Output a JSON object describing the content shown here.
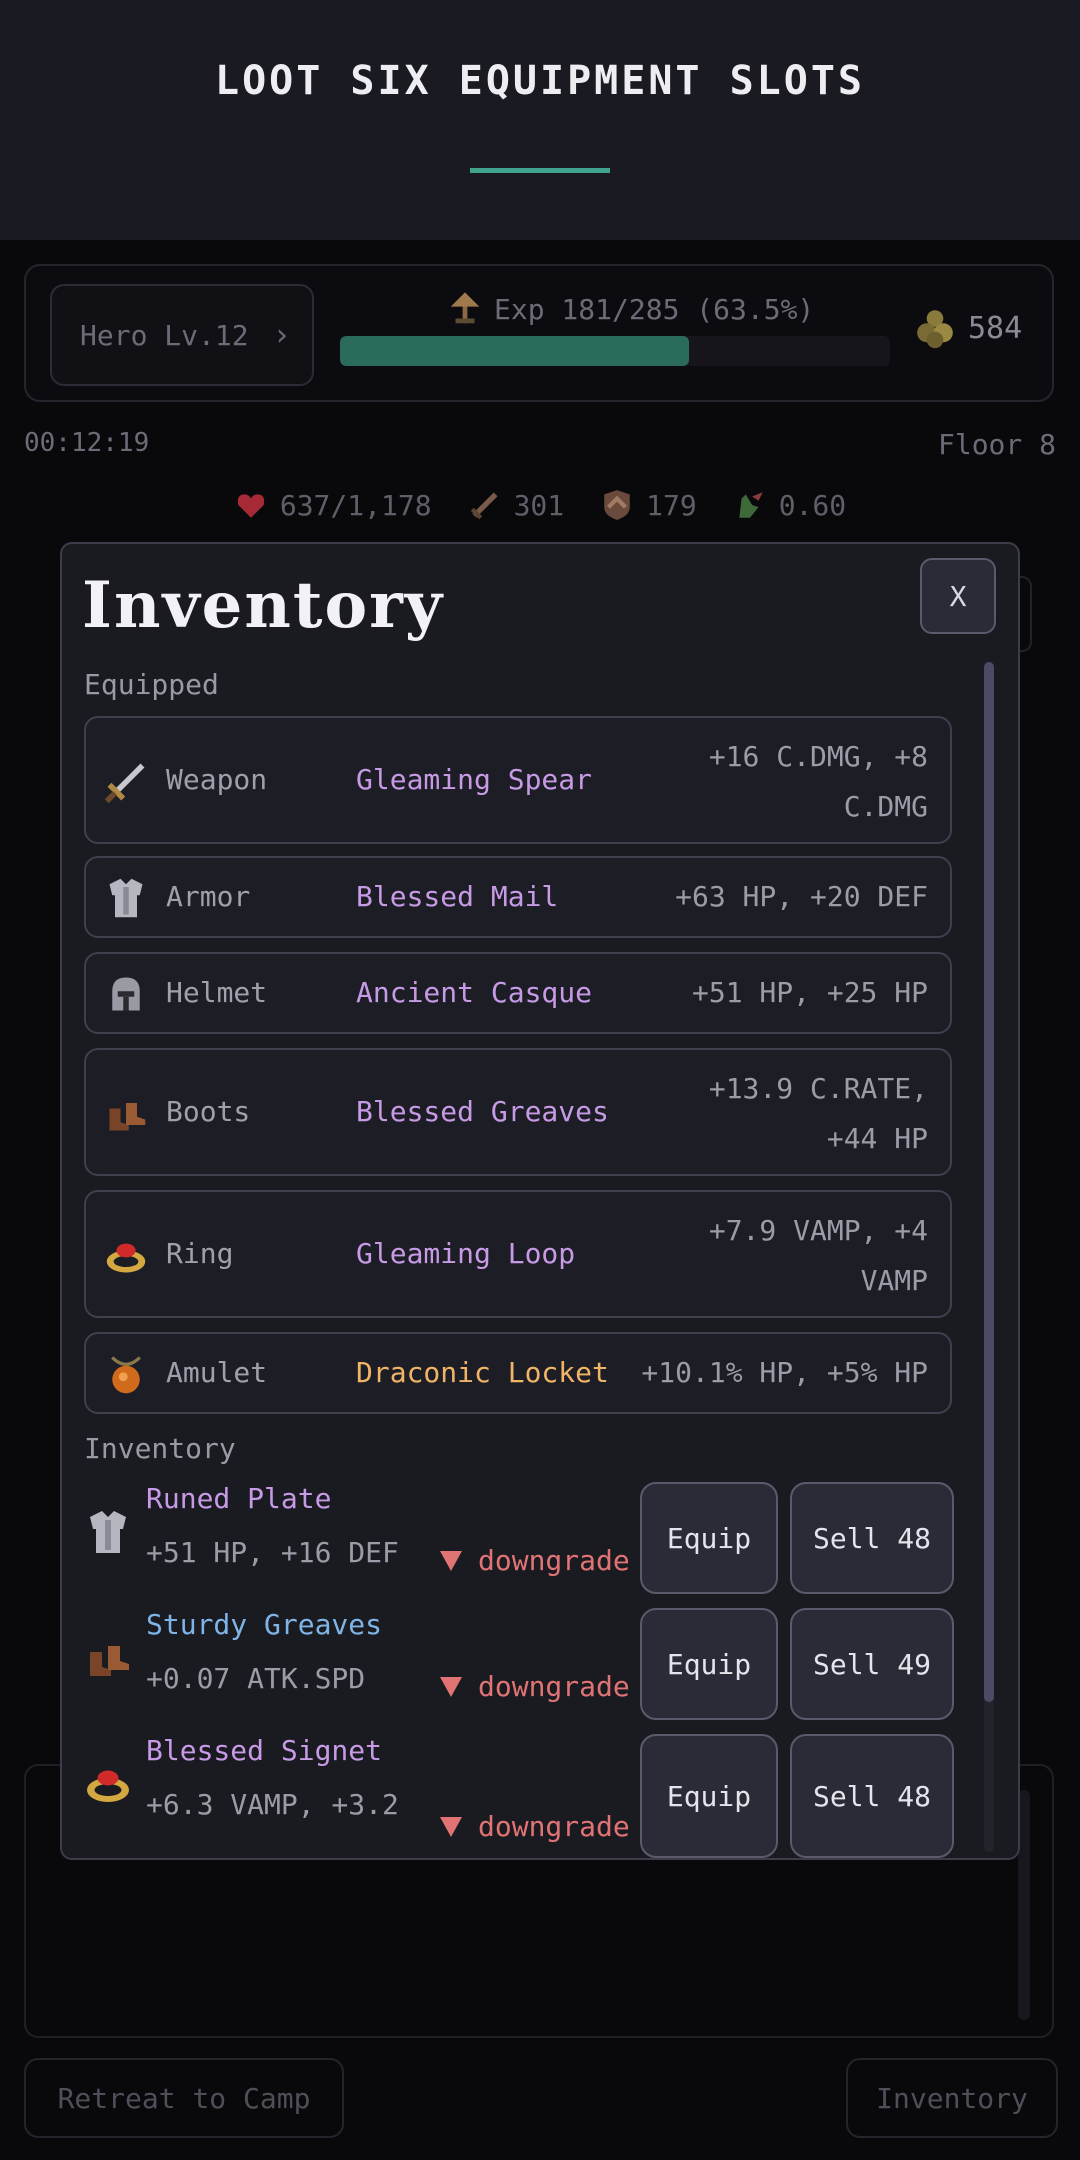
{
  "header": {
    "title": "LOOT SIX EQUIPMENT SLOTS"
  },
  "status": {
    "hero_label": "Hero Lv.12",
    "exp_label": "Exp 181/285 (63.5%)",
    "exp_fraction": 0.635,
    "gold": "584",
    "timer": "00:12:19",
    "floor": "Floor 8"
  },
  "stats": {
    "hp": "637/1,178",
    "attack": "301",
    "defense": "179",
    "speed": "0.60"
  },
  "modal": {
    "title": "Inventory",
    "close_label": "X",
    "equipped_label": "Equipped",
    "inventory_label": "Inventory",
    "equipped": [
      {
        "slot": "Weapon",
        "name": "Gleaming Spear",
        "stats_line1": "+16 C.DMG, +8",
        "stats_line2": "C.DMG",
        "rarity_color": "#c79ae6",
        "icon": "sword-icon"
      },
      {
        "slot": "Armor",
        "name": "Blessed Mail",
        "stats_line1": "+63 HP, +20 DEF",
        "stats_line2": "",
        "rarity_color": "#c79ae6",
        "icon": "chestplate-icon"
      },
      {
        "slot": "Helmet",
        "name": "Ancient Casque",
        "stats_line1": "+51 HP, +25 HP",
        "stats_line2": "",
        "rarity_color": "#c79ae6",
        "icon": "helmet-icon"
      },
      {
        "slot": "Boots",
        "name": "Blessed Greaves",
        "stats_line1": "+13.9 C.RATE,",
        "stats_line2": "+44 HP",
        "rarity_color": "#c79ae6",
        "icon": "boots-icon"
      },
      {
        "slot": "Ring",
        "name": "Gleaming Loop",
        "stats_line1": "+7.9 VAMP, +4",
        "stats_line2": "VAMP",
        "rarity_color": "#c79ae6",
        "icon": "ring-icon"
      },
      {
        "slot": "Amulet",
        "name": "Draconic Locket",
        "stats_line1": "+10.1% HP, +5% HP",
        "stats_line2": "",
        "rarity_color": "#f0b466",
        "icon": "amulet-icon"
      }
    ],
    "inventory": [
      {
        "name": "Runed Plate",
        "stats": "+51 HP, +16 DEF",
        "compare": "downgrade",
        "equip_label": "Equip",
        "sell_label": "Sell 48",
        "rarity_color": "#c79ae6",
        "icon": "chestplate-icon"
      },
      {
        "name": "Sturdy Greaves",
        "stats": "+0.07 ATK.SPD",
        "compare": "downgrade",
        "equip_label": "Equip",
        "sell_label": "Sell 49",
        "rarity_color": "#7fb4e6",
        "icon": "boots-icon"
      },
      {
        "name": "Blessed Signet",
        "stats": "+6.3 VAMP, +3.2",
        "compare": "downgrade",
        "equip_label": "Equip",
        "sell_label": "Sell 48",
        "rarity_color": "#c79ae6",
        "icon": "ring-icon"
      }
    ]
  },
  "footer": {
    "retreat_label": "Retreat to Camp",
    "inventory_label": "Inventory"
  }
}
